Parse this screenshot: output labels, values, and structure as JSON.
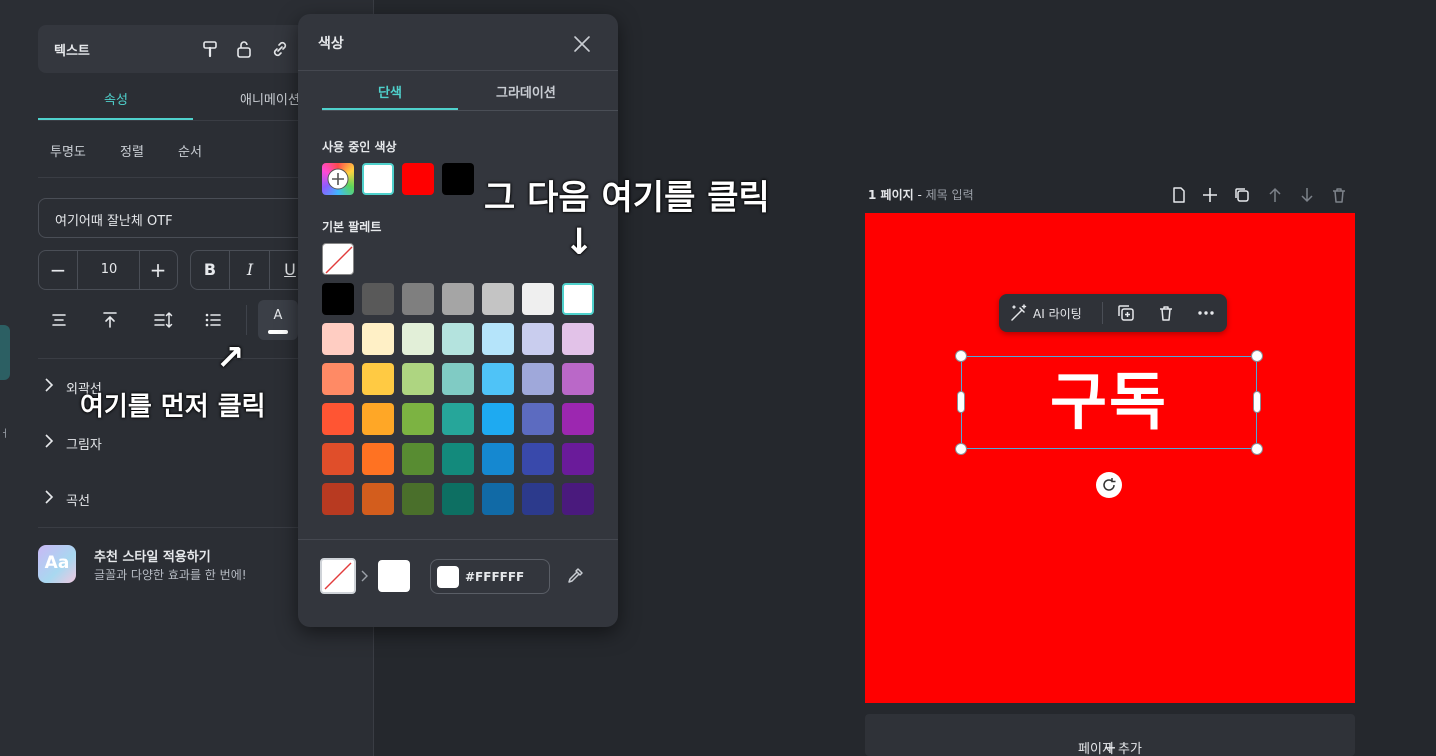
{
  "panel": {
    "header_title": "텍스트",
    "tabs": [
      "속성",
      "애니메이션"
    ],
    "subtabs": [
      "투명도",
      "정렬",
      "순서"
    ],
    "font_name": "여기어때 잘난체 OTF",
    "font_size": "10",
    "style_buttons": [
      "B",
      "I",
      "U"
    ],
    "text_color_letter": "A",
    "accordion": [
      "외곽선",
      "그림자",
      "곡선"
    ],
    "recommend_icon": "Aa",
    "recommend_title": "추천 스타일 적용하기",
    "recommend_sub": "글꼴과 다양한 효과를 한 번에!"
  },
  "annotations": {
    "first": "여기를 먼저 클릭",
    "second": "그 다음 여기를 클릭",
    "arrow_first": "↗",
    "arrow_second": "↓"
  },
  "color_popup": {
    "title": "색상",
    "tabs": [
      "단색",
      "그라데이션"
    ],
    "used_label": "사용 중인 색상",
    "used_colors": [
      "#ffffff",
      "#ff0000",
      "#000000"
    ],
    "palette_label": "기본 팔레트",
    "palette": [
      [
        "#000000",
        "#595959",
        "#7f7f7f",
        "#a5a5a5",
        "#c4c4c4",
        "#efefef",
        "#ffffff"
      ],
      [
        "#ffcdc2",
        "#fff0c6",
        "#e2efd8",
        "#b4e3de",
        "#b5e4fa",
        "#c9cdee",
        "#e2c2e8"
      ],
      [
        "#ff8a65",
        "#ffca43",
        "#aed581",
        "#80cbc4",
        "#4fc3f7",
        "#9fa8da",
        "#ba68c8"
      ],
      [
        "#ff5533",
        "#ffa726",
        "#7cb342",
        "#26a69a",
        "#1eaaf1",
        "#5c6bc0",
        "#9c27b0"
      ],
      [
        "#e04e2a",
        "#ff7222",
        "#588c32",
        "#138a7c",
        "#1588d0",
        "#3949ab",
        "#6a1b9a"
      ],
      [
        "#b83a21",
        "#d35d1d",
        "#4a6f2b",
        "#0d6f62",
        "#116aa6",
        "#2c3a8c",
        "#4a1a7d"
      ]
    ],
    "current_hex": "#FFFFFF",
    "accent": "#4fd1cc"
  },
  "page": {
    "label": "1 페이지",
    "title_placeholder": "제목 입력",
    "canvas_color": "#ff0000",
    "canvas_text": "구독",
    "toolbar_ai": "AI 라이팅",
    "add_page": "페이지 추가"
  },
  "sidebar_strip_text": "ㅓ"
}
